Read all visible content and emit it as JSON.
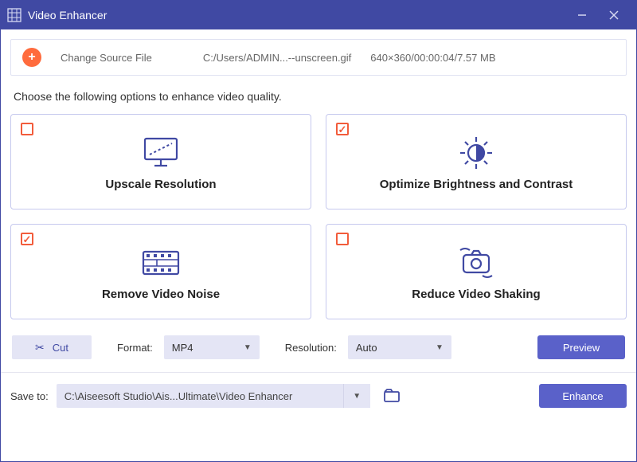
{
  "app": {
    "title": "Video Enhancer"
  },
  "source": {
    "change_label": "Change Source File",
    "path": "C:/Users/ADMIN...--unscreen.gif",
    "meta": "640×360/00:00:04/7.57 MB"
  },
  "instruction": "Choose the following options to enhance video quality.",
  "options": {
    "upscale": {
      "label": "Upscale Resolution",
      "checked": false
    },
    "brightness": {
      "label": "Optimize Brightness and Contrast",
      "checked": true
    },
    "noise": {
      "label": "Remove Video Noise",
      "checked": true
    },
    "shaking": {
      "label": "Reduce Video Shaking",
      "checked": false
    }
  },
  "controls": {
    "cut_label": "Cut",
    "format_label": "Format:",
    "format_value": "MP4",
    "resolution_label": "Resolution:",
    "resolution_value": "Auto",
    "preview_label": "Preview"
  },
  "save": {
    "label": "Save to:",
    "path": "C:\\Aiseesoft Studio\\Ais...Ultimate\\Video Enhancer",
    "enhance_label": "Enhance"
  }
}
